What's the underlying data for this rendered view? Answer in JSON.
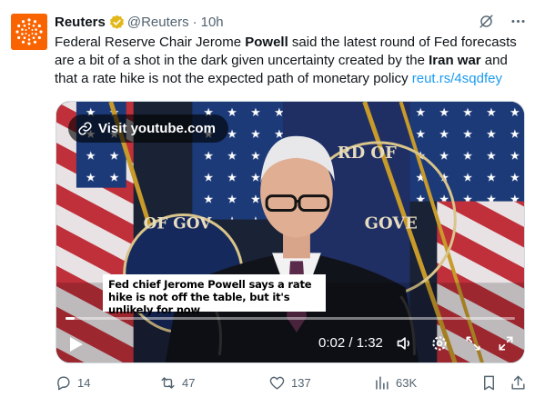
{
  "tweet": {
    "author_name": "Reuters",
    "handle": "@Reuters",
    "separator": "·",
    "time": "10h",
    "text": {
      "t1": "Federal Reserve Chair Jerome ",
      "b1": "Powell",
      "t2": " said the latest round of Fed forecasts are a bit of a shot in the dark given uncertainty created by the ",
      "b2": "Iran war",
      "t3": " and that a rate hike is not the expected path of monetary policy ",
      "link": "reut.rs/4sqdfey"
    }
  },
  "media": {
    "visit_label": "Visit youtube.com",
    "caption": "Fed chief Jerome Powell says a rate hike is not off the table, but it's unlikely for now",
    "timecode": "0:02 / 1:32",
    "progress_fraction": 0.02
  },
  "actions": {
    "replies": "14",
    "reposts": "47",
    "likes": "137",
    "views": "63K"
  },
  "icons": {
    "avatar": "reuters-logo-icon",
    "verified": "verified-badge-icon",
    "grok": "grok-icon",
    "more": "more-icon",
    "link": "link-icon",
    "play": "play-icon",
    "volume": "volume-icon",
    "settings": "settings-icon",
    "exit_fullscreen": "exit-fullscreen-icon",
    "fullscreen": "fullscreen-icon",
    "reply": "reply-icon",
    "repost": "repost-icon",
    "like": "like-icon",
    "views": "views-icon",
    "bookmark": "bookmark-icon",
    "share": "share-icon"
  },
  "colors": {
    "reuters_orange": "#fa6400",
    "link_blue": "#1d9bf0",
    "verified_gold": "#e2b719",
    "muted_text": "#536471"
  }
}
